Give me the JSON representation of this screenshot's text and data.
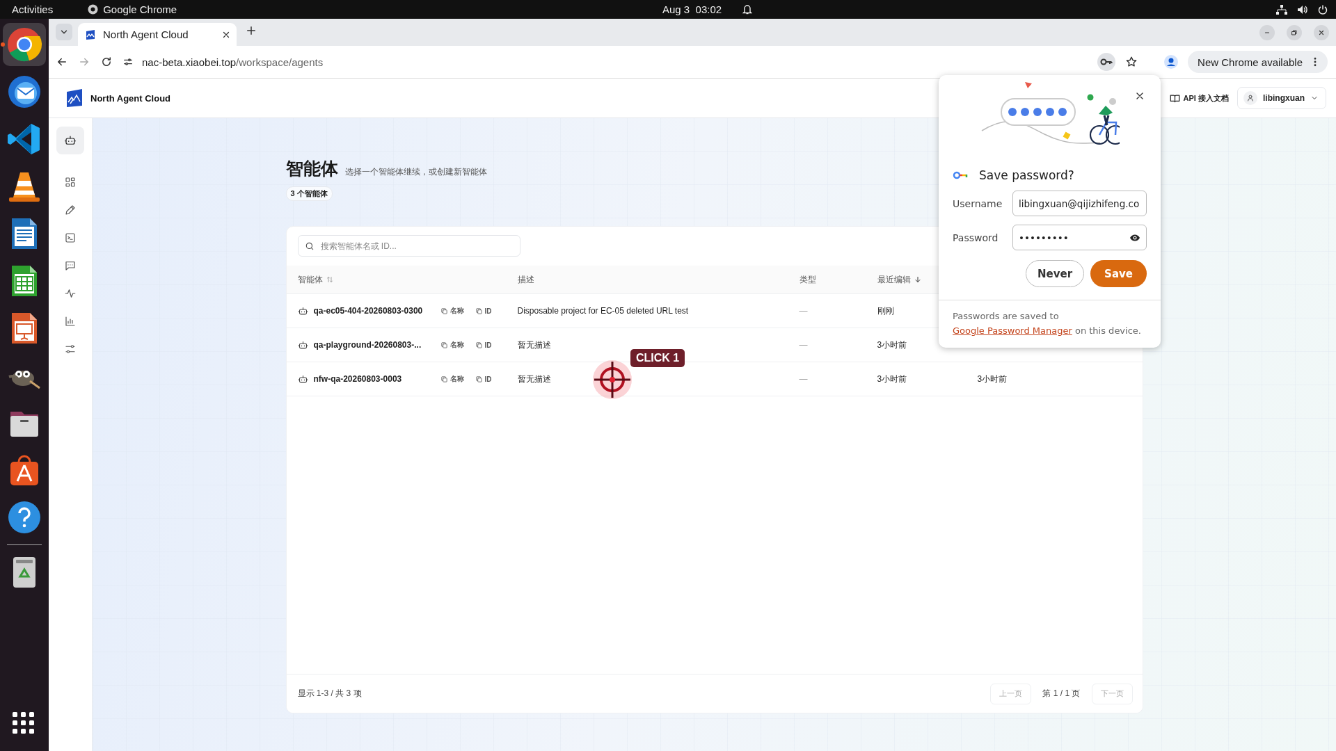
{
  "system_bar": {
    "activities": "Activities",
    "app": "Google Chrome",
    "date": "Aug 3",
    "time": "03:02"
  },
  "dock": {
    "items": [
      {
        "kind": "chrome",
        "running": true
      },
      {
        "kind": "mail",
        "running": false
      },
      {
        "kind": "code",
        "running": false
      },
      {
        "kind": "cone",
        "running": false
      },
      {
        "kind": "writer",
        "running": false
      },
      {
        "kind": "calc",
        "running": false
      },
      {
        "kind": "impress",
        "running": false
      },
      {
        "kind": "gimp",
        "running": false
      },
      {
        "kind": "files",
        "running": false
      },
      {
        "kind": "store",
        "running": false
      },
      {
        "kind": "help",
        "running": false
      },
      {
        "kind": "trash",
        "running": false
      }
    ]
  },
  "browser": {
    "tab_title": "North Agent Cloud",
    "url_host": "nac-beta.xiaobei.top",
    "url_path": "/workspace/agents",
    "update_button": "New Chrome available"
  },
  "app": {
    "brand": "North Agent Cloud",
    "api_docs": "API 接入文档",
    "user": "libingxuan"
  },
  "sidebar": {
    "items": [
      {
        "kind": "robot",
        "selected": true
      },
      {
        "kind": "grid",
        "selected": false
      },
      {
        "kind": "pen",
        "selected": false
      },
      {
        "kind": "terminal",
        "selected": false
      },
      {
        "kind": "chat",
        "selected": false
      },
      {
        "kind": "pulse",
        "selected": false
      },
      {
        "kind": "chart",
        "selected": false
      },
      {
        "kind": "sliders",
        "selected": false
      }
    ]
  },
  "page": {
    "title": "智能体",
    "subtitle": "选择一个智能体继续，或创建新智能体",
    "count_badge": "3 个智能体"
  },
  "table": {
    "search_placeholder": "搜索智能体名或 ID...",
    "columns": [
      {
        "label": "智能体",
        "sortable": true,
        "sorted_descending": false
      },
      {
        "label": "描述",
        "sortable": false,
        "sorted_descending": false
      },
      {
        "label": "类型",
        "sortable": false,
        "sorted_descending": false
      },
      {
        "label": "最近编辑",
        "sortable": false,
        "sorted_descending": true
      }
    ],
    "rows": [
      {
        "name": "qa-ec05-404-20260803-0300",
        "copy_name": "名称",
        "copy_id": "ID",
        "description": "Disposable project for EC-05 deleted URL test",
        "type": "—",
        "edited": "刚刚"
      },
      {
        "name": "qa-playground-20260803-...",
        "copy_name": "名称",
        "copy_id": "ID",
        "description": "暂无描述",
        "type": "—",
        "edited": "3小时前"
      },
      {
        "name": "nfw-qa-20260803-0003",
        "copy_name": "名称",
        "copy_id": "ID",
        "description": "暂无描述",
        "type": "—",
        "edited": "3小时前",
        "column_5": "3小时前"
      }
    ]
  },
  "pagination": {
    "summary": "显示 1-3 / 共 3 项",
    "prev": "上一页",
    "prev_disabled": true,
    "page": "第 1 / 1 页",
    "next": "下一页",
    "next_disabled": true
  },
  "password_dialog": {
    "title": "Save password?",
    "username_label": "Username",
    "username": "libingxuan@qijizhifeng.co",
    "password_label": "Password",
    "password_mask": "•••••••••",
    "never": "Never",
    "save": "Save",
    "footer_before": "Passwords are saved to",
    "footer_link": "Google Password Manager",
    "footer_after": "on this device."
  },
  "click_marker": {
    "label": "CLICK 1"
  }
}
